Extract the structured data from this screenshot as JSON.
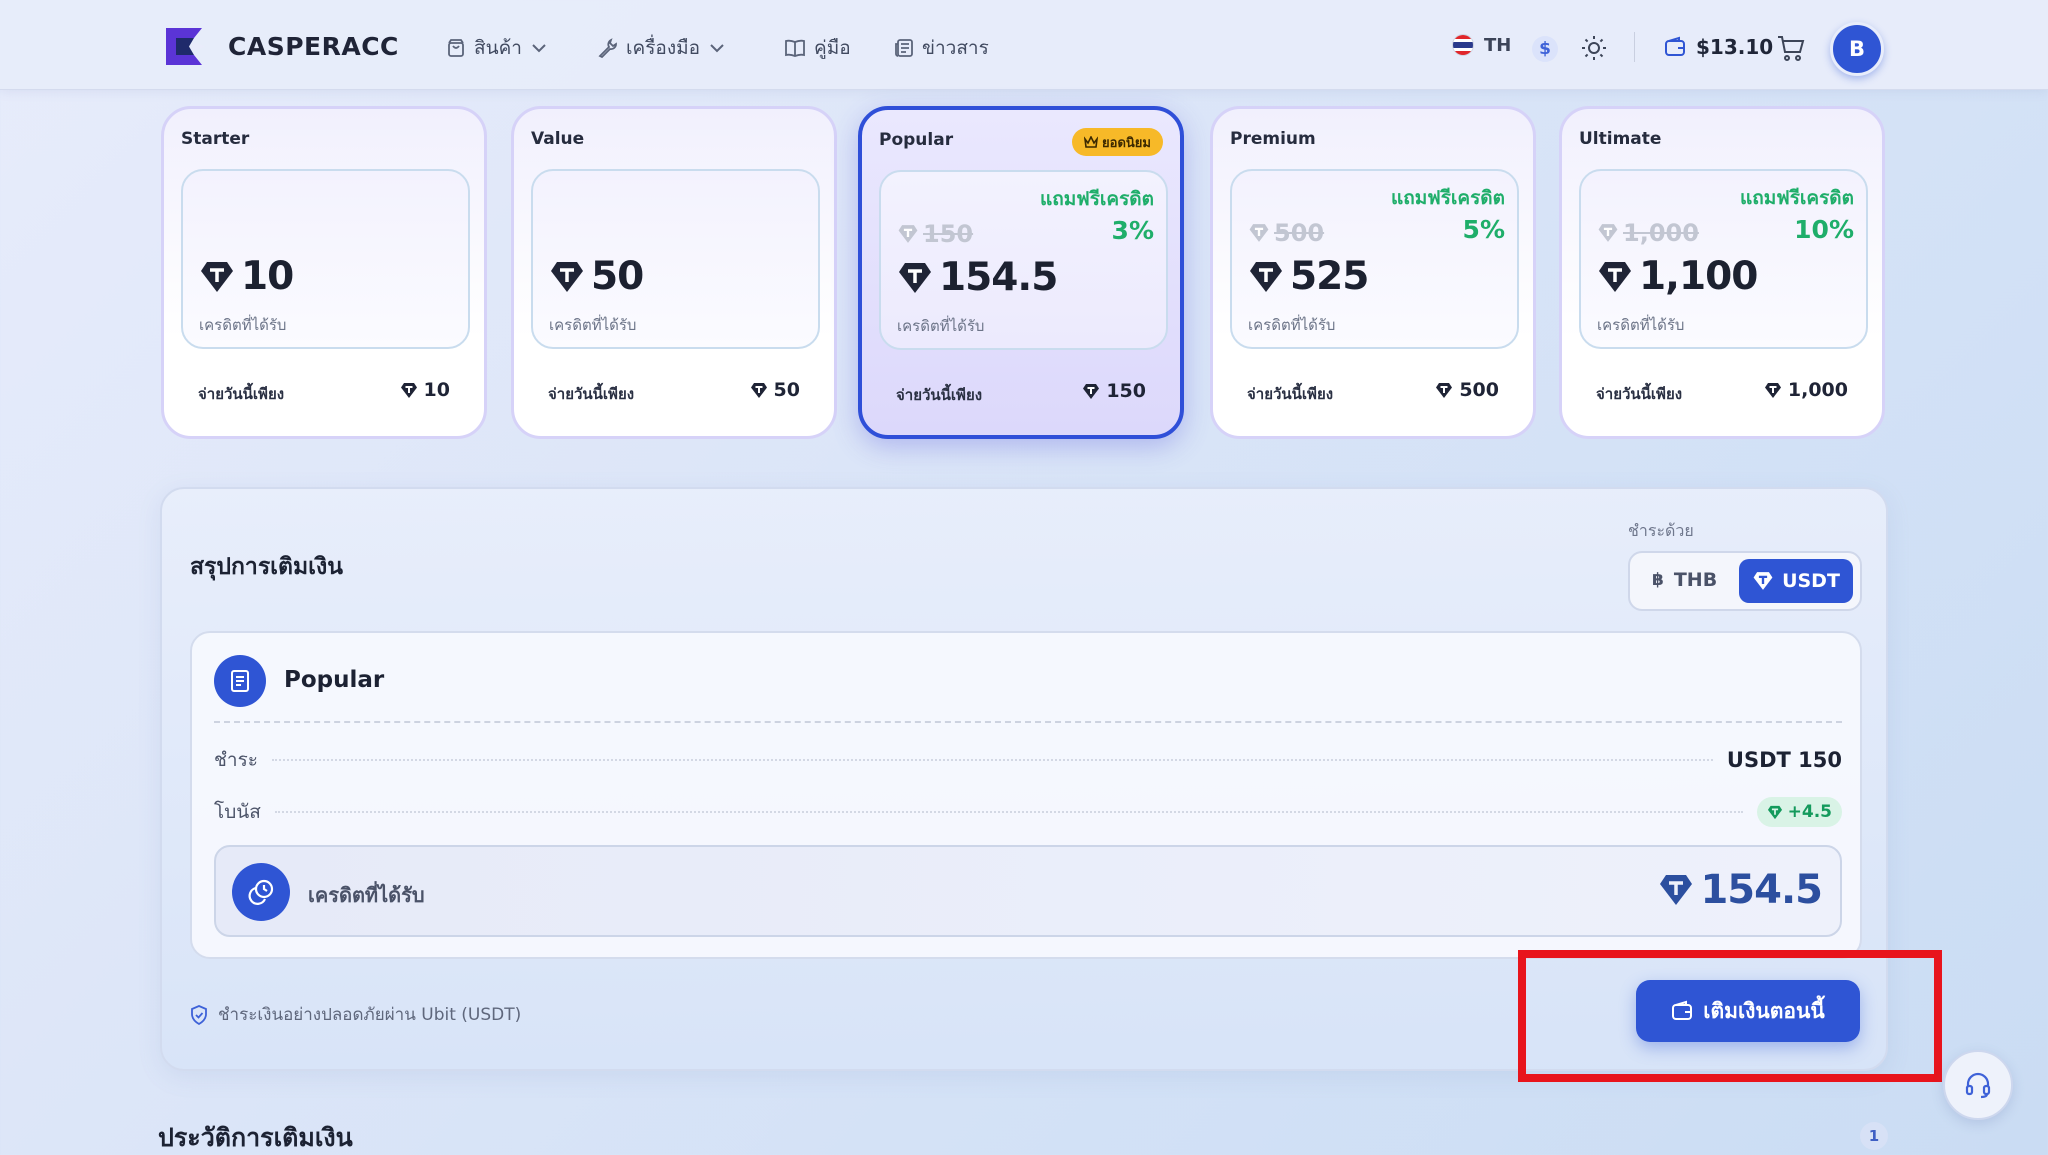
{
  "brand": {
    "name": "CASPERACC"
  },
  "nav": {
    "products": "สินค้า",
    "tools": "เครื่องมือ",
    "guide": "คู่มือ",
    "news": "ข่าวสาร"
  },
  "header": {
    "lang": "TH",
    "currency_symbol": "$",
    "balance": "$13.10",
    "avatar_initial": "B"
  },
  "packages": [
    {
      "name": "Starter",
      "credit": "10",
      "credit_label": "เครดิตที่ได้รับ",
      "pay_label": "จ่ายวันนี้เพียง",
      "pay": "10"
    },
    {
      "name": "Value",
      "credit": "50",
      "credit_label": "เครดิตที่ได้รับ",
      "pay_label": "จ่ายวันนี้เพียง",
      "pay": "50"
    },
    {
      "name": "Popular",
      "badge": "ยอดนิยม",
      "free_label": "แถมฟรีเครดิต",
      "free_pct": "3%",
      "old_price": "150",
      "credit": "154.5",
      "credit_label": "เครดิตที่ได้รับ",
      "pay_label": "จ่ายวันนี้เพียง",
      "pay": "150",
      "selected": true
    },
    {
      "name": "Premium",
      "free_label": "แถมฟรีเครดิต",
      "free_pct": "5%",
      "old_price": "500",
      "credit": "525",
      "credit_label": "เครดิตที่ได้รับ",
      "pay_label": "จ่ายวันนี้เพียง",
      "pay": "500"
    },
    {
      "name": "Ultimate",
      "free_label": "แถมฟรีเครดิต",
      "free_pct": "10%",
      "old_price": "1,000",
      "credit": "1,100",
      "credit_label": "เครดิตที่ได้รับ",
      "pay_label": "จ่ายวันนี้เพียง",
      "pay": "1,000"
    }
  ],
  "summary": {
    "title": "สรุปการเติมเงิน",
    "pay_with_label": "ชำระด้วย",
    "currencies": [
      "THB",
      "USDT"
    ],
    "selected_currency": "USDT",
    "package_name": "Popular",
    "pay_label": "ชำระ",
    "pay_value": "USDT 150",
    "bonus_label": "โบนัส",
    "bonus_value": "+4.5",
    "received_label": "เครดิตที่ได้รับ",
    "received_value": "154.5",
    "secure_note": "ชำระเงินอย่างปลอดภัยผ่าน Ubit (USDT)",
    "topup_button": "เติมเงินตอนนี้"
  },
  "history": {
    "title": "ประวัติการเติมเงิน",
    "count": "1"
  },
  "colors": {
    "accent": "#2f55d4",
    "bonus_green": "#1fae6a",
    "badge_yellow": "#f7b928",
    "highlight_red": "#e8141c"
  }
}
